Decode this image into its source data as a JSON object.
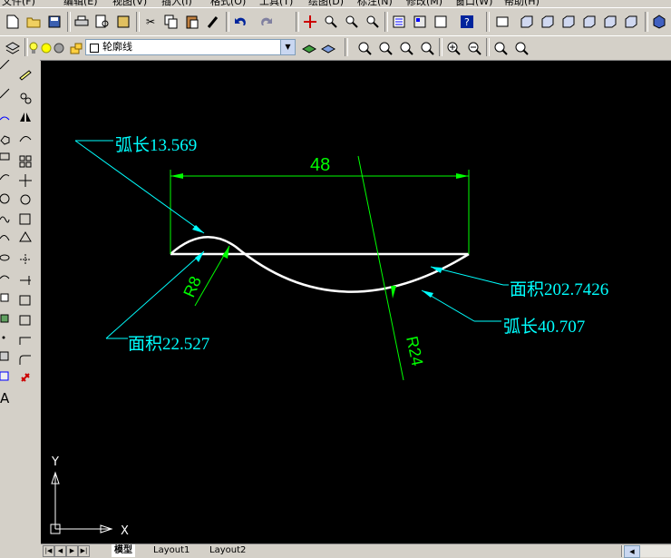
{
  "menu": [
    "文件(F)",
    "编辑(E)",
    "视图(V)",
    "插入(I)",
    "格式(O)",
    "工具(T)",
    "绘图(D)",
    "标注(N)",
    "修改(M)",
    "窗口(W)",
    "帮助(H)"
  ],
  "layer": {
    "name": "轮廓线"
  },
  "drawing": {
    "dim_linear": "48",
    "arc_small_length": "弧长13.569",
    "arc_small_area": "面积22.527",
    "arc_small_radius": "R8",
    "arc_large_area": "面积202.7426",
    "arc_large_length": "弧长40.707",
    "arc_large_radius": "R24",
    "colors": {
      "background": "#000000",
      "geometry": "#ffffff",
      "dimension": "#00ff00",
      "annotation": "#00ffff"
    }
  },
  "ucs": {
    "x_label": "X",
    "y_label": "Y"
  },
  "tabs": [
    "模型",
    "Layout1",
    "Layout2"
  ],
  "icons": {
    "toolbar_top": [
      "new-icon",
      "open-icon",
      "save-icon",
      "print-icon",
      "preview-icon",
      "publish-icon",
      "cut-icon",
      "copy-icon",
      "paste-icon",
      "matchprop-icon",
      "undo-icon",
      "redo-icon",
      "pan-icon",
      "zoom-realtime-icon",
      "zoom-window-icon",
      "zoom-previous-icon",
      "properties-icon",
      "design-center-icon",
      "tool-palette-icon",
      "help-icon",
      "ucs-icon",
      "view-top-icon",
      "view-bottom-icon",
      "view-left-icon",
      "view-right-icon",
      "view-front-icon",
      "view-back-icon",
      "shade-icon"
    ],
    "toolbar_layer": [
      "layer-manager-icon",
      "bulb-icon",
      "sun-icon",
      "lock-icon",
      "color-icon",
      "make-current-icon",
      "layer-previous-icon",
      "zoom-window2-icon",
      "zoom-dynamic-icon",
      "zoom-scale-icon",
      "zoom-center-icon",
      "zoom-in-icon",
      "zoom-out-icon",
      "zoom-all-icon",
      "zoom-extents-icon"
    ],
    "draw": [
      "line-icon",
      "xline-icon",
      "pline-icon",
      "polygon-icon",
      "rectangle-icon",
      "arc-icon",
      "circle-icon",
      "revcloud-icon",
      "spline-icon",
      "ellipse-icon",
      "ellipse-arc-icon",
      "insert-block-icon",
      "make-block-icon",
      "point-icon",
      "hatch-icon",
      "region-icon",
      "table-icon",
      "mtext-icon"
    ],
    "modify": [
      "erase-icon",
      "copy-obj-icon",
      "mirror-icon",
      "offset-icon",
      "array-icon",
      "move-icon",
      "rotate-icon",
      "scale-icon",
      "stretch-icon",
      "trim-icon",
      "extend-icon",
      "break-point-icon",
      "break-icon",
      "join-icon",
      "chamfer-icon",
      "fillet-icon",
      "explode-icon"
    ]
  }
}
